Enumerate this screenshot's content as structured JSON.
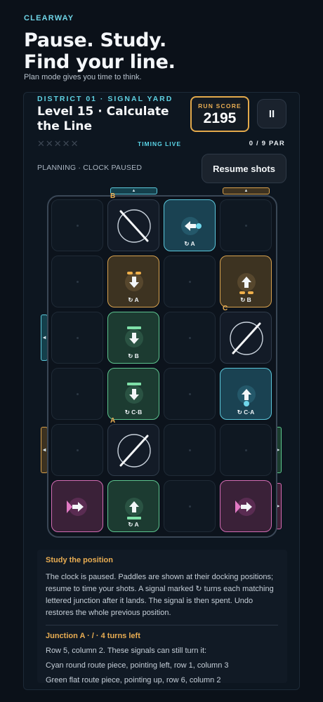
{
  "app": {
    "brand": "CLEARWAY",
    "headline": [
      "Pause. Study.",
      "Find your line."
    ],
    "tagline": "Plan mode gives you time to think."
  },
  "level": {
    "district": "DISTRICT 01 · SIGNAL YARD",
    "title": "Level 15 · Calculate the Line",
    "timing": "TIMING LIVE",
    "par": "0 / 9 PAR",
    "status": "PLANNING · CLOCK PAUSED",
    "missed_marks": "✕✕✕✕✕"
  },
  "score": {
    "label": "RUN SCORE",
    "value": "2195"
  },
  "controls": {
    "pause_label": "II",
    "resume_label": "Resume shots"
  },
  "colors": {
    "cyan": "#5cc8dc",
    "amber": "#e9ad52",
    "green": "#5dc48f",
    "pink": "#d26cb3",
    "background": "#0b1119"
  },
  "board": {
    "rows": 6,
    "cols": 4,
    "cells": [
      {
        "row": 1,
        "col": 1,
        "type": "empty"
      },
      {
        "row": 1,
        "col": 2,
        "type": "mirror",
        "orientation": "backslash",
        "junction": "B"
      },
      {
        "row": 1,
        "col": 3,
        "type": "cyan",
        "icon": "arrow-left",
        "tag": "↻ A"
      },
      {
        "row": 1,
        "col": 4,
        "type": "empty"
      },
      {
        "row": 2,
        "col": 1,
        "type": "empty"
      },
      {
        "row": 2,
        "col": 2,
        "type": "amber",
        "icon": "arrow-down",
        "tag": "↻ A"
      },
      {
        "row": 2,
        "col": 3,
        "type": "empty"
      },
      {
        "row": 2,
        "col": 4,
        "type": "amber",
        "icon": "arrow-up",
        "tag": "↻ B"
      },
      {
        "row": 3,
        "col": 1,
        "type": "empty"
      },
      {
        "row": 3,
        "col": 2,
        "type": "green",
        "icon": "arrow-down",
        "tag": "↻ B"
      },
      {
        "row": 3,
        "col": 3,
        "type": "empty"
      },
      {
        "row": 3,
        "col": 4,
        "type": "mirror",
        "orientation": "slash",
        "junction": "C"
      },
      {
        "row": 4,
        "col": 1,
        "type": "empty"
      },
      {
        "row": 4,
        "col": 2,
        "type": "green",
        "icon": "arrow-down",
        "tag": "↻ C·B"
      },
      {
        "row": 4,
        "col": 3,
        "type": "empty"
      },
      {
        "row": 4,
        "col": 4,
        "type": "cyan",
        "icon": "arrow-up",
        "tag": "↻ C·A"
      },
      {
        "row": 5,
        "col": 1,
        "type": "empty"
      },
      {
        "row": 5,
        "col": 2,
        "type": "mirror",
        "orientation": "slash",
        "junction": "A"
      },
      {
        "row": 5,
        "col": 3,
        "type": "empty"
      },
      {
        "row": 5,
        "col": 4,
        "type": "empty"
      },
      {
        "row": 6,
        "col": 1,
        "type": "pink",
        "icon": "arrow-right"
      },
      {
        "row": 6,
        "col": 2,
        "type": "green",
        "icon": "arrow-up",
        "tag": "↻ A"
      },
      {
        "row": 6,
        "col": 3,
        "type": "empty"
      },
      {
        "row": 6,
        "col": 4,
        "type": "pink",
        "icon": "arrow-right"
      }
    ]
  },
  "info": {
    "title": "Study the position",
    "body": "The clock is paused. Paddles are shown at their docking positions; resume to time your shots. A signal marked ↻ turns each matching lettered junction after it lands. The signal is then spent. Undo restores the whole previous position.",
    "junction_title": "Junction A · / · 4 turns left",
    "lines": [
      "Row 5, column 2. These signals can still turn it:",
      "Cyan round route piece, pointing left, row 1, column 3",
      "Green flat route piece, pointing up, row 6, column 2"
    ]
  }
}
